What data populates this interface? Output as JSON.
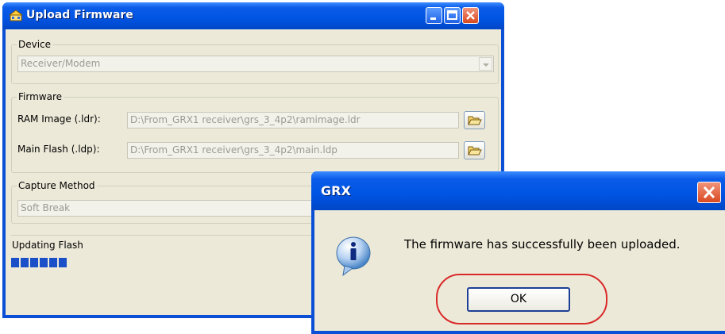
{
  "main_window": {
    "title": "Upload Firmware",
    "device_group": {
      "label": "Device",
      "value": "Receiver/Modem"
    },
    "firmware_group": {
      "label": "Firmware",
      "ram_label": "RAM Image (.ldr):",
      "ram_value": "D:\\From_GRX1 receiver\\grs_3_4p2\\ramimage.ldr",
      "flash_label": "Main Flash (.ldp):",
      "flash_value": "D:\\From_GRX1 receiver\\grs_3_4p2\\main.ldp"
    },
    "capture_group": {
      "label": "Capture Method",
      "value": "Soft Break"
    },
    "status_label": "Updating Flash",
    "progress_segments": 6
  },
  "dialog": {
    "title": "GRX",
    "message": "The firmware has successfully been uploaded.",
    "ok_label": "OK"
  },
  "colors": {
    "titlebar_blue": "#0054e3",
    "progress_blue": "#1a4fc8",
    "highlight_red": "#d92a2a",
    "window_bg": "#ece9d8"
  },
  "icons": [
    "app-icon",
    "minimize-icon",
    "maximize-icon",
    "close-icon",
    "folder-open-icon",
    "info-icon",
    "dropdown-arrow-icon"
  ]
}
